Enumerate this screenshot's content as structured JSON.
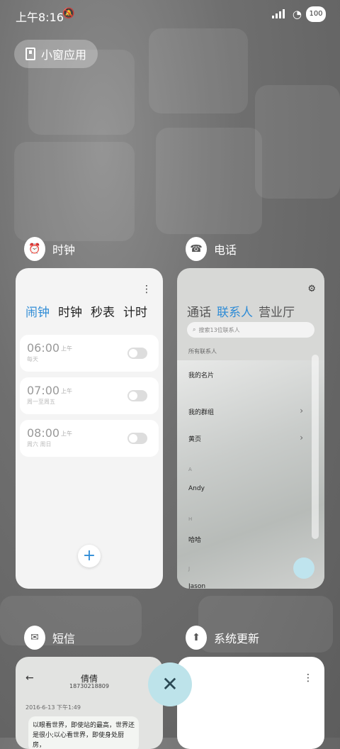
{
  "status": {
    "time": "上午8:16",
    "battery": "100"
  },
  "small_window": {
    "label": "小窗应用"
  },
  "apps": {
    "clock": {
      "name": "时钟",
      "tabs": [
        "闹钟",
        "时钟",
        "秒表",
        "计时"
      ],
      "alarms": [
        {
          "time": "06:00",
          "ampm": "上午",
          "repeat": "每天"
        },
        {
          "time": "07:00",
          "ampm": "上午",
          "repeat": "周一至周五"
        },
        {
          "time": "08:00",
          "ampm": "上午",
          "repeat": "周六 周日"
        }
      ]
    },
    "phone": {
      "name": "电话",
      "tabs": [
        "通话",
        "联系人",
        "营业厅"
      ],
      "search_placeholder": "搜索13位联系人",
      "all_contacts": "所有联系人",
      "rows": {
        "my_card": "我的名片",
        "my_groups": "我的群组",
        "yellow_pages": "黄页",
        "letter_a": "A",
        "andy": "Andy",
        "letter_h": "H",
        "haha": "哈哈",
        "letter_j": "J",
        "jason": "Jason"
      }
    },
    "messages": {
      "name": "短信",
      "contact": "倩倩",
      "number": "18730218809",
      "date": "2016-6-13 下午1:49",
      "bubble": "以眼看世界，即使站的最高，世界还是很小;以心看世界，即使身处厨房，"
    },
    "update": {
      "name": "系统更新"
    }
  },
  "colors": {
    "accent": "#2f8cd6",
    "close_bg": "#bde3ea"
  }
}
